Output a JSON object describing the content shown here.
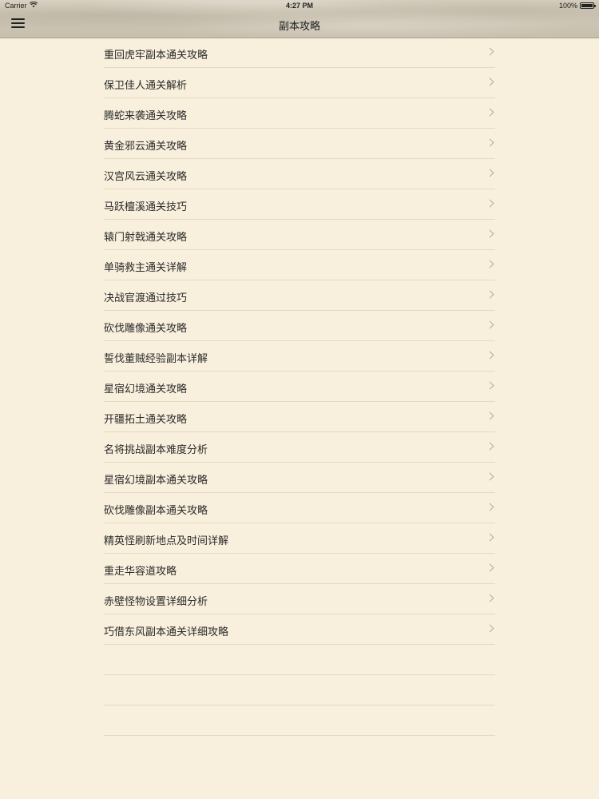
{
  "status_bar": {
    "carrier": "Carrier",
    "time": "4:27 PM",
    "battery": "100%"
  },
  "header": {
    "title": "副本攻略",
    "menu_icon": "hamburger-menu-icon"
  },
  "list": {
    "items": [
      {
        "label": "重回虎牢副本通关攻略"
      },
      {
        "label": "保卫佳人通关解析"
      },
      {
        "label": "腾蛇来袭通关攻略"
      },
      {
        "label": "黄金邪云通关攻略"
      },
      {
        "label": "汉宫风云通关攻略"
      },
      {
        "label": "马跃檀溪通关技巧"
      },
      {
        "label": "辕门射戟通关攻略"
      },
      {
        "label": "单骑救主通关详解"
      },
      {
        "label": "决战官渡通过技巧"
      },
      {
        "label": "砍伐雕像通关攻略"
      },
      {
        "label": "誓伐董贼经验副本详解"
      },
      {
        "label": "星宿幻境通关攻略"
      },
      {
        "label": "开疆拓土通关攻略"
      },
      {
        "label": "名将挑战副本难度分析"
      },
      {
        "label": "星宿幻境副本通关攻略"
      },
      {
        "label": "砍伐雕像副本通关攻略"
      },
      {
        "label": "精英怪刷新地点及时间详解"
      },
      {
        "label": "重走华容道攻略"
      },
      {
        "label": "赤壁怪物设置详细分析"
      },
      {
        "label": "巧借东风副本通关详细攻略"
      }
    ],
    "chevron_icon": "chevron-right-icon"
  },
  "colors": {
    "background": "#f8efdc",
    "separator": "#e4d9c3",
    "text": "#2b2b2b",
    "chevron": "#b4ab99"
  }
}
